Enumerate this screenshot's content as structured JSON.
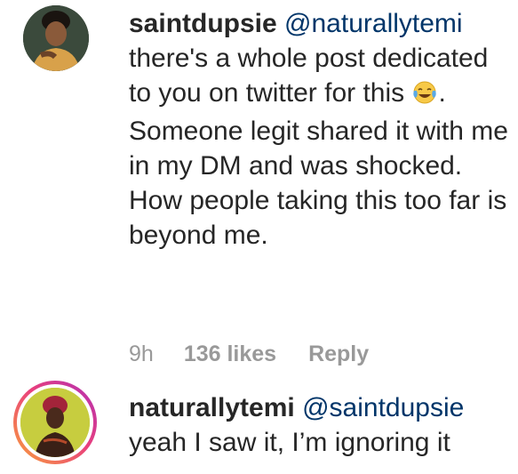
{
  "comments": [
    {
      "username": "saintdupsie",
      "mention": "@naturallytemi",
      "text_before_emoji": "there's a whole post dedicated to you on twitter for this",
      "emoji": "face-with-tears-of-joy-icon",
      "text_after_emoji": ". Someone legit shared it with me in my DM and was shocked. How people taking this too far is beyond me.",
      "time": "9h",
      "likes": "136 likes",
      "reply_label": "Reply"
    },
    {
      "username": "naturallytemi",
      "mention": "@saintdupsie",
      "text": "yeah I saw it, I’m ignoring it"
    }
  ],
  "colors": {
    "text": "#262626",
    "mention": "#003569",
    "meta": "#999999",
    "story_ring_start": "#f9a13a",
    "story_ring_end": "#b12fb5"
  }
}
